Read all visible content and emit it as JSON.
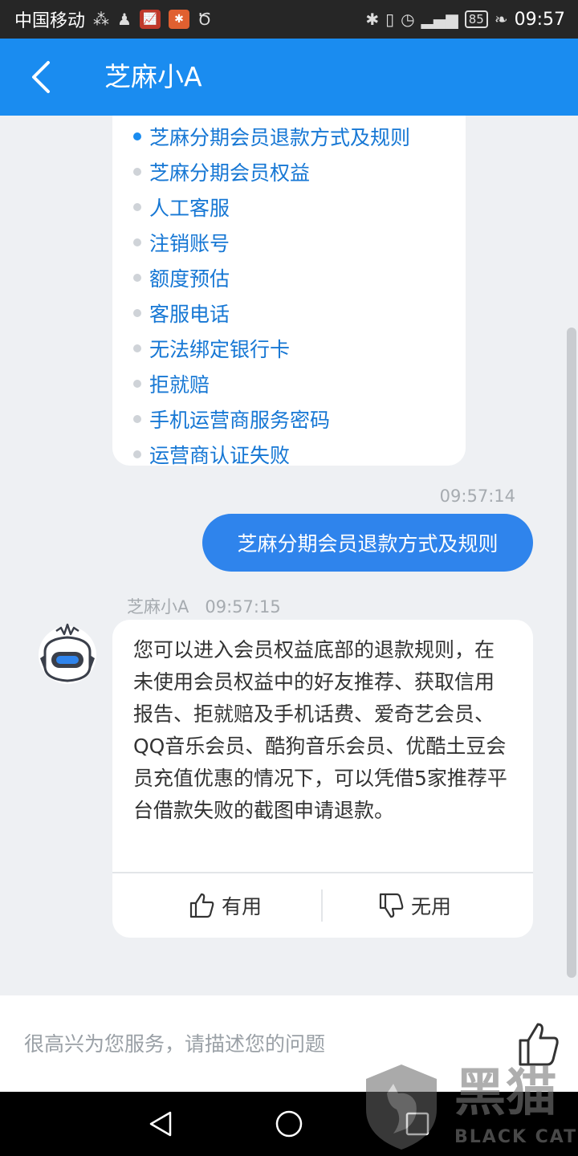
{
  "status_bar": {
    "carrier": "中国移动",
    "battery": "85",
    "time": "09:57"
  },
  "nav": {
    "title": "芝麻小A"
  },
  "question_list": [
    {
      "label": "芝麻分期会员退款方式及规则",
      "active": true
    },
    {
      "label": "芝麻分期会员权益",
      "active": false
    },
    {
      "label": "人工客服",
      "active": false
    },
    {
      "label": "注销账号",
      "active": false
    },
    {
      "label": "额度预估",
      "active": false
    },
    {
      "label": "客服电话",
      "active": false
    },
    {
      "label": "无法绑定银行卡",
      "active": false
    },
    {
      "label": "拒就赔",
      "active": false
    },
    {
      "label": "手机运营商服务密码",
      "active": false
    },
    {
      "label": "运营商认证失败",
      "active": false
    }
  ],
  "user_message": {
    "time": "09:57:14",
    "text": "芝麻分期会员退款方式及规则"
  },
  "bot_message": {
    "sender": "芝麻小A",
    "time": "09:57:15",
    "text": "您可以进入会员权益底部的退款规则，在未使用会员权益中的好友推荐、获取信用报告、拒就赔及手机话费、爱奇艺会员、QQ音乐会员、酷狗音乐会员、优酷土豆会员充值优惠的情况下，可以凭借5家推荐平台借款失败的截图申请退款。",
    "useful_label": "有用",
    "useless_label": "无用"
  },
  "input": {
    "placeholder": "很高兴为您服务，请描述您的问题",
    "value": ""
  },
  "watermark": {
    "text": "黑猫",
    "sub": "BLACK CAT"
  },
  "colors": {
    "brand_blue": "#1a8cf0",
    "user_bubble": "#2f84ec",
    "link_text": "#1677d4"
  }
}
